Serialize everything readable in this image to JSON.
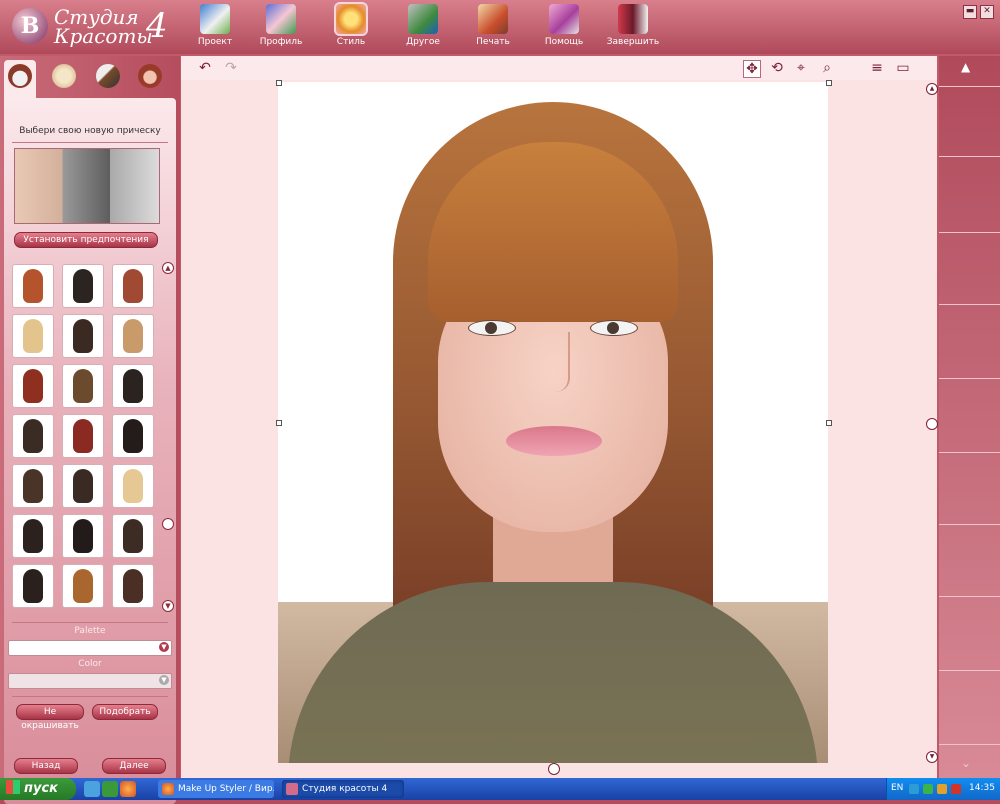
{
  "app": {
    "logo": {
      "line1": "Студия",
      "line2": "Красоты",
      "number": "4"
    }
  },
  "menu": [
    {
      "label": "Проект",
      "icon": "project-icon"
    },
    {
      "label": "Профиль",
      "icon": "profile-icon"
    },
    {
      "label": "Стиль",
      "icon": "style-icon",
      "active": true
    },
    {
      "label": "Другое",
      "icon": "other-icon"
    },
    {
      "label": "Печать",
      "icon": "print-icon"
    },
    {
      "label": "Помощь",
      "icon": "help-icon"
    },
    {
      "label": "Завершить",
      "icon": "exit-icon"
    }
  ],
  "window_controls": {
    "minimize": "▬",
    "close": "✕"
  },
  "left_panel": {
    "prompt": "Выбери свою новую прическу",
    "preferences_button": "Установить предпочтения",
    "palette_label": "Palette",
    "color_label": "Color",
    "no_color_button": "Не окрашивать",
    "pick_button": "Подобрать",
    "back_button": "Назад",
    "next_button": "Далее"
  },
  "toolbar": {
    "undo": "↶",
    "redo": "↷",
    "move": "✥",
    "rotate": "⟲",
    "center": "⌖",
    "zoom": "⌕",
    "menu": "≡",
    "view": "▭"
  },
  "right_panel": {
    "up": "▲",
    "down": "⌄"
  },
  "taskbar": {
    "start_label": "пуск",
    "tasks": [
      {
        "label": "Make Up Styler / Вир...",
        "icon": "firefox-icon"
      },
      {
        "label": "Студия красоты 4",
        "icon": "beauty-studio-icon",
        "active": true
      }
    ],
    "language": "EN",
    "clock": "14:35"
  },
  "colors": {
    "accent": "#b54c5c",
    "panel": "#fbe9ec",
    "canvas": "#fbe2e3",
    "taskbar": "#245edb",
    "start": "#3c9a3c"
  }
}
